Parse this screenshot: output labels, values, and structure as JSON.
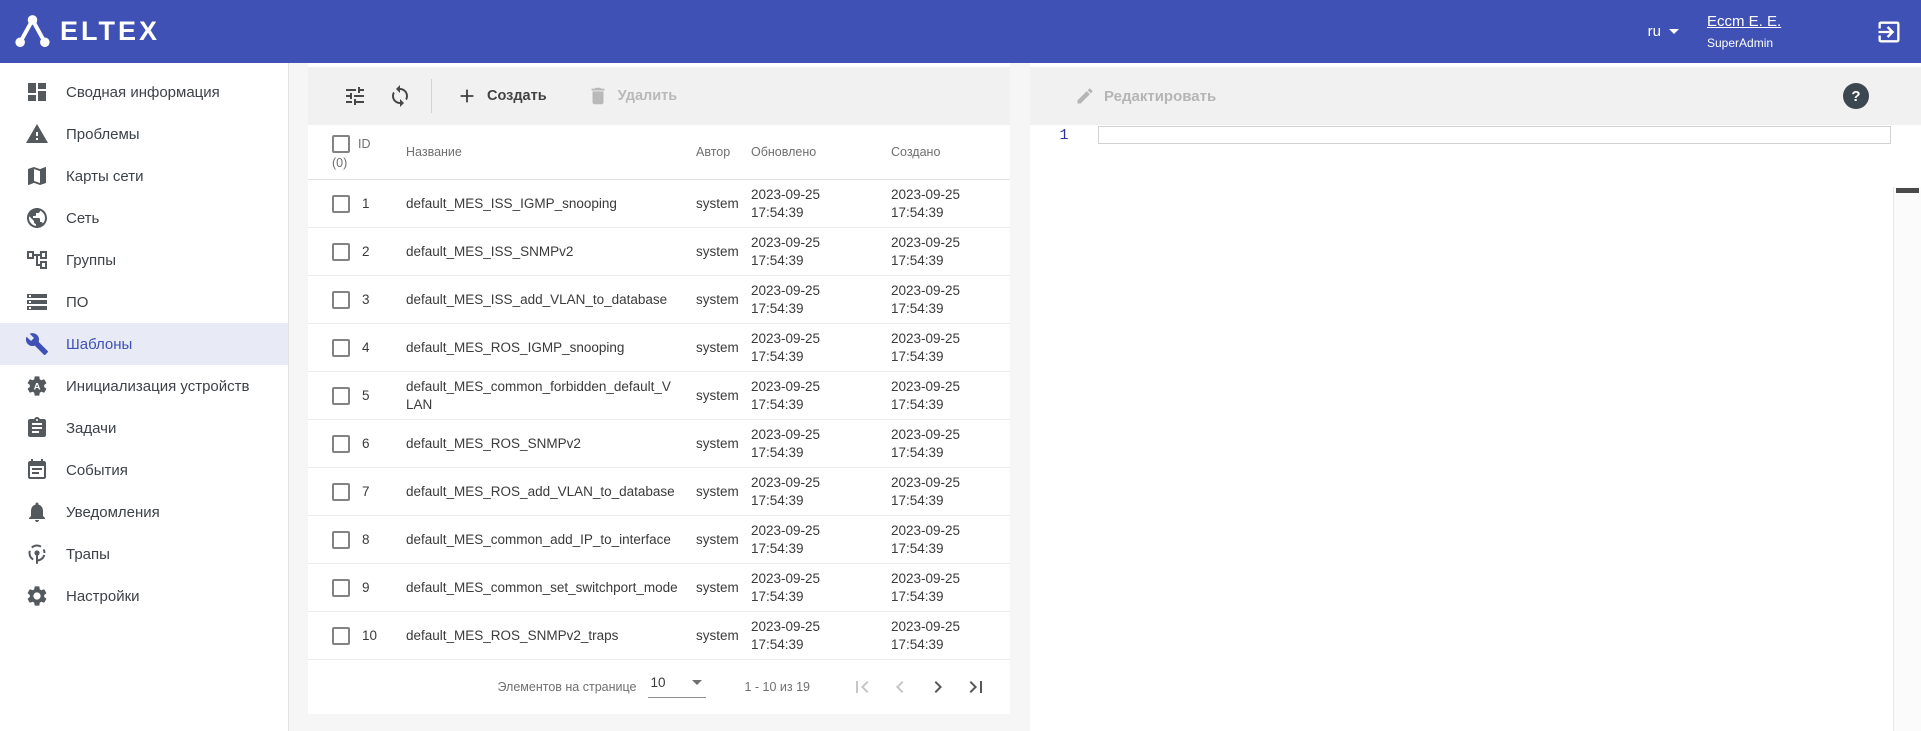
{
  "header": {
    "brand": "ELTEX",
    "language": "ru",
    "user_name": "Eccm E. E.",
    "user_role": "SuperAdmin"
  },
  "colors": {
    "header_bg": "#3f51b5",
    "active_item_bg": "#e8eaf6",
    "active_item_fg": "#3f51b5",
    "line_number_fg": "#283593"
  },
  "sidebar": {
    "items": [
      {
        "key": "summary",
        "label": "Сводная информация",
        "icon": "dashboard-icon",
        "active": false
      },
      {
        "key": "problems",
        "label": "Проблемы",
        "icon": "warning-icon",
        "active": false
      },
      {
        "key": "network-maps",
        "label": "Карты сети",
        "icon": "map-icon",
        "active": false
      },
      {
        "key": "network",
        "label": "Сеть",
        "icon": "globe-icon",
        "active": false
      },
      {
        "key": "groups",
        "label": "Группы",
        "icon": "tree-icon",
        "active": false
      },
      {
        "key": "software",
        "label": "ПО",
        "icon": "storage-icon",
        "active": false
      },
      {
        "key": "templates",
        "label": "Шаблоны",
        "icon": "wrench-icon",
        "active": true
      },
      {
        "key": "device-init",
        "label": "Инициализация устройств",
        "icon": "device-init-icon",
        "active": false
      },
      {
        "key": "tasks",
        "label": "Задачи",
        "icon": "tasks-icon",
        "active": false
      },
      {
        "key": "events",
        "label": "События",
        "icon": "calendar-icon",
        "active": false
      },
      {
        "key": "notifications",
        "label": "Уведомления",
        "icon": "bell-icon",
        "active": false
      },
      {
        "key": "traps",
        "label": "Трапы",
        "icon": "traps-icon",
        "active": false
      },
      {
        "key": "settings",
        "label": "Настройки",
        "icon": "gear-icon",
        "active": false
      }
    ]
  },
  "toolbar": {
    "create_label": "Создать",
    "delete_label": "Удалить"
  },
  "table": {
    "columns": {
      "id": "ID",
      "count": "(0)",
      "name": "Название",
      "author": "Автор",
      "updated": "Обновлено",
      "created": "Создано"
    },
    "rows": [
      {
        "id": "1",
        "name": "default_MES_ISS_IGMP_snooping",
        "author": "system",
        "updated": "2023-09-25 17:54:39",
        "created": "2023-09-25 17:54:39"
      },
      {
        "id": "2",
        "name": "default_MES_ISS_SNMPv2",
        "author": "system",
        "updated": "2023-09-25 17:54:39",
        "created": "2023-09-25 17:54:39"
      },
      {
        "id": "3",
        "name": "default_MES_ISS_add_VLAN_to_database",
        "author": "system",
        "updated": "2023-09-25 17:54:39",
        "created": "2023-09-25 17:54:39"
      },
      {
        "id": "4",
        "name": "default_MES_ROS_IGMP_snooping",
        "author": "system",
        "updated": "2023-09-25 17:54:39",
        "created": "2023-09-25 17:54:39"
      },
      {
        "id": "5",
        "name": "default_MES_common_forbidden_default_VLAN",
        "author": "system",
        "updated": "2023-09-25 17:54:39",
        "created": "2023-09-25 17:54:39"
      },
      {
        "id": "6",
        "name": "default_MES_ROS_SNMPv2",
        "author": "system",
        "updated": "2023-09-25 17:54:39",
        "created": "2023-09-25 17:54:39"
      },
      {
        "id": "7",
        "name": "default_MES_ROS_add_VLAN_to_database",
        "author": "system",
        "updated": "2023-09-25 17:54:39",
        "created": "2023-09-25 17:54:39"
      },
      {
        "id": "8",
        "name": "default_MES_common_add_IP_to_interface",
        "author": "system",
        "updated": "2023-09-25 17:54:39",
        "created": "2023-09-25 17:54:39"
      },
      {
        "id": "9",
        "name": "default_MES_common_set_switchport_mode",
        "author": "system",
        "updated": "2023-09-25 17:54:39",
        "created": "2023-09-25 17:54:39"
      },
      {
        "id": "10",
        "name": "default_MES_ROS_SNMPv2_traps",
        "author": "system",
        "updated": "2023-09-25 17:54:39",
        "created": "2023-09-25 17:54:39"
      }
    ]
  },
  "pagination": {
    "items_per_page_label": "Элементов на странице",
    "items_per_page_value": "10",
    "range_label": "1 - 10 из 19"
  },
  "editor_panel": {
    "edit_label": "Редактировать",
    "help_label": "?",
    "line_number": "1",
    "content": ""
  }
}
